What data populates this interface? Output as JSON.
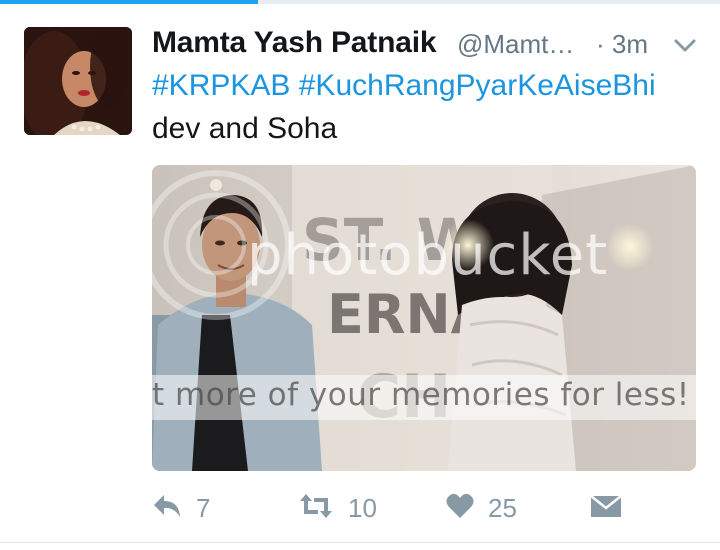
{
  "tweet": {
    "author_name": "Mamta Yash Patnaik",
    "author_handle": "@Mamt…",
    "timestamp": "· 3m",
    "hashtags": [
      "#KRPKAB",
      "#KuchRangPyarKeAiseBhi"
    ],
    "text": "dev and Soha",
    "media": {
      "watermark_top": "photobucket",
      "watermark_bottom": "t more of your memories for less!"
    }
  },
  "actions": {
    "reply_count": "7",
    "retweet_count": "10",
    "like_count": "25"
  },
  "icons": {
    "menu": "chevron-down-icon",
    "reply": "reply-icon",
    "retweet": "retweet-icon",
    "like": "heart-icon",
    "dm": "envelope-icon"
  },
  "colors": {
    "accent": "#1b95e0",
    "muted": "#8899a6",
    "text": "#14171a",
    "handle": "#657786"
  }
}
